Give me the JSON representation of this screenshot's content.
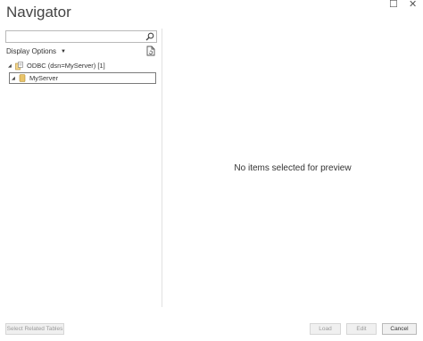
{
  "window": {
    "title": "Navigator",
    "maximize_glyph": "☐",
    "close_glyph": "✕"
  },
  "search": {
    "value": "",
    "placeholder": ""
  },
  "display_options": {
    "label": "Display Options"
  },
  "tree": {
    "root": {
      "label": "ODBC (dsn=MyServer) [1]",
      "icon": "odbc-icon",
      "expanded": true
    },
    "child": {
      "label": "MyServer",
      "icon": "folder-icon",
      "expanded": true,
      "selected": true
    }
  },
  "preview": {
    "empty_message": "No items selected for preview"
  },
  "footer": {
    "select_related_label": "Select Related Tables",
    "load_label": "Load",
    "edit_label": "Edit",
    "cancel_label": "Cancel"
  },
  "colors": {
    "border": "#b9b9b9",
    "folder": "#e9c46a",
    "button_bg": "#f0f0f0"
  }
}
